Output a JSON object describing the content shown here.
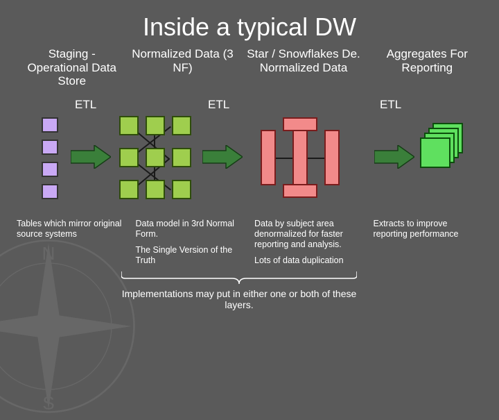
{
  "title": "Inside a typical DW",
  "stages": [
    {
      "header": "Staging - Operational Data Store",
      "etl_label": "ETL",
      "desc": [
        "Tables which mirror original source systems"
      ]
    },
    {
      "header": "Normalized Data (3 NF)",
      "etl_label": "ETL",
      "desc": [
        "Data model in 3rd Normal Form.",
        "The Single Version of the Truth"
      ]
    },
    {
      "header": "Star / Snowflakes De. Normalized Data",
      "etl_label": "ETL",
      "desc": [
        "Data by subject area denormalized for faster reporting and analysis.",
        "Lots of data duplication"
      ]
    },
    {
      "header": "Aggregates For Reporting",
      "desc": [
        "Extracts to improve reporting performance"
      ]
    }
  ],
  "implementation_note": "Implementations may put in either one or both of these layers.",
  "colors": {
    "background": "#5a5a5a",
    "stage1_box": "#c9a9f5",
    "stage2_box": "#9fce4e",
    "stage3_box": "#f28a8a",
    "stage4_box": "#5fe05f",
    "arrow": "#3a7f3a"
  },
  "icons": {
    "arrow": "etl-arrow-icon",
    "compass": "compass-watermark-icon"
  }
}
